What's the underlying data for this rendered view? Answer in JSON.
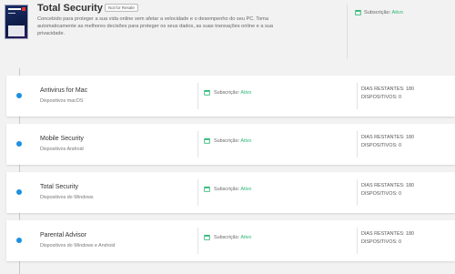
{
  "product": {
    "title": "Total Security",
    "tag": "Not for Resale",
    "description": "Concebido para proteger a sua vida online sem afetar a velocidade e o desempenho do seu PC. Toma automaticamente as melhores decisões para proteger os seus dados, as suas transações online e a sua privacidade.",
    "subscription_label": "Subscrição:",
    "subscription_status": "Ativo"
  },
  "colors": {
    "accent": "#1e90e0",
    "active": "#2bb673"
  },
  "cards": [
    {
      "name": "Antivirus for Mac",
      "device": "Dispositivos macOS",
      "sub_label": "Subscrição:",
      "sub_status": "Ativo",
      "days": "DIAS RESTANTES: 180",
      "devices": "DISPOSITIVOS: 0"
    },
    {
      "name": "Mobile Security",
      "device": "Dispositivos Android",
      "sub_label": "Subscrição:",
      "sub_status": "Ativo",
      "days": "DIAS RESTANTES: 180",
      "devices": "DISPOSITIVOS: 0"
    },
    {
      "name": "Total Security",
      "device": "Dispositivos do Windows",
      "sub_label": "Subscrição:",
      "sub_status": "Ativo",
      "days": "DIAS RESTANTES: 180",
      "devices": "DISPOSITIVOS: 0"
    },
    {
      "name": "Parental Advisor",
      "device": "Dispositivos do Windows e Android",
      "sub_label": "Subscrição:",
      "sub_status": "Ativo",
      "days": "DIAS RESTANTES: 180",
      "devices": "DISPOSITIVOS: 0"
    }
  ]
}
